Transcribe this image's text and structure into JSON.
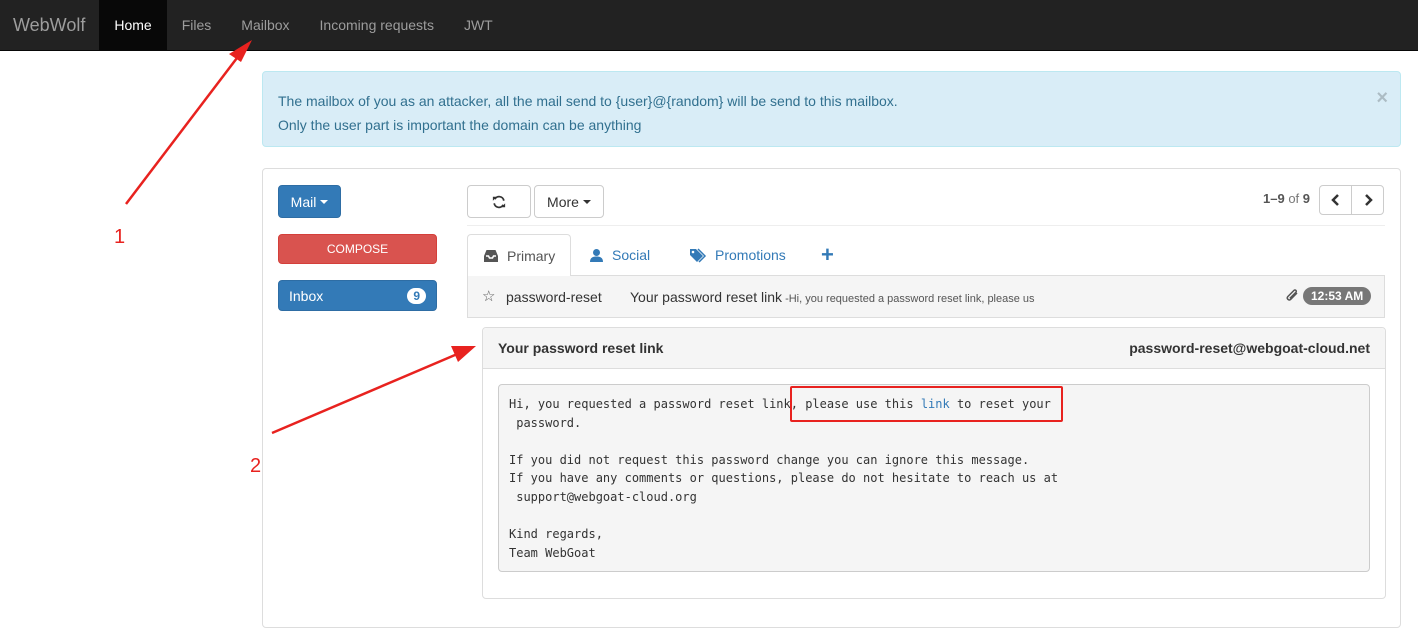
{
  "navbar": {
    "brand": "WebWolf",
    "items": [
      {
        "label": "Home",
        "active": true
      },
      {
        "label": "Files"
      },
      {
        "label": "Mailbox"
      },
      {
        "label": "Incoming requests"
      },
      {
        "label": "JWT"
      }
    ]
  },
  "alert": {
    "line1": "The mailbox of you as an attacker, all the mail send to {user}@{random} will be send to this mailbox.",
    "line2": "Only the user part is important the domain can be anything",
    "close": "×"
  },
  "sidebar": {
    "mail_button": "Mail",
    "compose_button": "COMPOSE",
    "inbox_label": "Inbox",
    "inbox_count": "9"
  },
  "toolbar": {
    "refresh_icon": "refresh-icon",
    "more_label": "More",
    "pager_range": "1–9",
    "pager_of": "of",
    "pager_total": "9"
  },
  "tabs": [
    {
      "label": "Primary",
      "icon": "inbox-icon",
      "active": true
    },
    {
      "label": "Social",
      "icon": "user-icon"
    },
    {
      "label": "Promotions",
      "icon": "tag-icon"
    },
    {
      "label": "+",
      "icon": "plus-icon"
    }
  ],
  "mail_list": [
    {
      "sender": "password-reset",
      "subject": "Your password reset link",
      "preview": " -Hi, you requested a password reset link, please us",
      "time": "12:53 AM",
      "has_attachment": true
    }
  ],
  "message": {
    "subject": "Your password reset link",
    "from": "password-reset@webgoat-cloud.net",
    "body_before_link": "Hi, you requested a password reset link, please use this ",
    "link_text": "link",
    "body_after_link": " to reset your\n password.\n\nIf you did not request this password change you can ignore this message.\nIf you have any comments or questions, please do not hesitate to reach us at\n support@webgoat-cloud.org\n\nKind regards,\nTeam WebGoat"
  },
  "annotations": {
    "label1": "1",
    "label2": "2",
    "color": "#e8221f"
  },
  "colors": {
    "primary": "#337ab7",
    "danger": "#d9534f",
    "navbar": "#222222",
    "alert_bg": "#d9edf7"
  }
}
